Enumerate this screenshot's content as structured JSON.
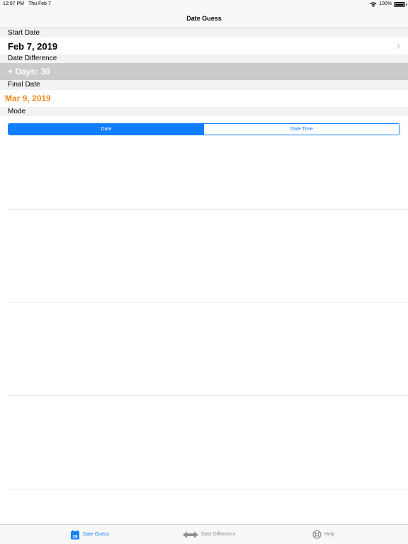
{
  "status_bar": {
    "time": "12:07 PM",
    "date": "Thu Feb 7",
    "battery": "100%"
  },
  "nav": {
    "title": "Date Guess"
  },
  "start_date": {
    "header": "Start Date",
    "value": "Feb 7, 2019"
  },
  "date_difference": {
    "header": "Date Difference",
    "value": "+ Days: 30"
  },
  "final_date": {
    "header": "Final Date",
    "value": "Mar 9, 2019"
  },
  "mode": {
    "header": "Mode",
    "segments": [
      {
        "label": "Date",
        "selected": true
      },
      {
        "label": "Date Time",
        "selected": false
      }
    ]
  },
  "tab_bar": {
    "tabs": [
      {
        "label": "Date Guess",
        "icon": "calendar-icon",
        "icon_text": "28",
        "active": true
      },
      {
        "label": "Date Difference",
        "icon": "arrows-icon",
        "active": false
      },
      {
        "label": "Help",
        "icon": "lifebuoy-icon",
        "active": false
      }
    ]
  },
  "colors": {
    "accent": "#117eff",
    "final_date": "#ee8a1d",
    "disabled_row": "#cbcbcb"
  }
}
